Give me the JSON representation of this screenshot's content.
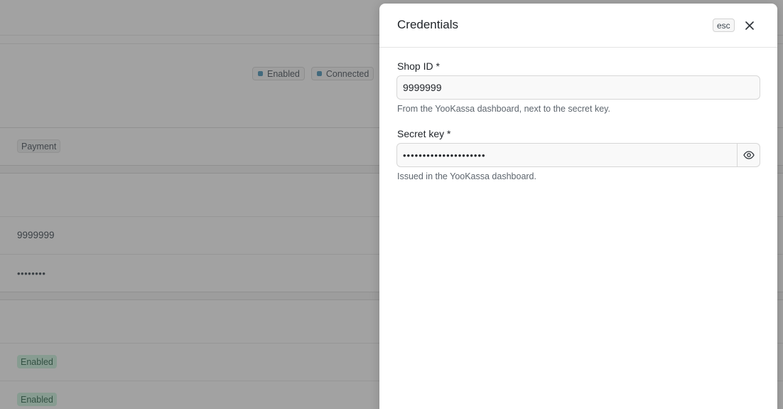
{
  "background": {
    "status_badges": [
      "Enabled",
      "Connected"
    ],
    "type_chip": "Payment",
    "shop_id_value": "9999999",
    "secret_masked": "••••••••",
    "flag_chips": [
      "Enabled",
      "Enabled"
    ]
  },
  "drawer": {
    "title": "Credentials",
    "esc_label": "esc",
    "shop_id": {
      "label": "Shop ID *",
      "value": "9999999",
      "help": "From the YooKassa dashboard, next to the secret key."
    },
    "secret_key": {
      "label": "Secret key *",
      "masked_value": "•••••••••••••••••••••",
      "help": "Issued in the YooKassa dashboard."
    }
  },
  "colors": {
    "overlay": "rgba(70,70,70,0.5)",
    "badge_dot": "#3f8fb5",
    "chip_green_bg": "#c9f2dd"
  },
  "icons": {
    "close": "close-icon",
    "reveal": "eye-icon"
  }
}
